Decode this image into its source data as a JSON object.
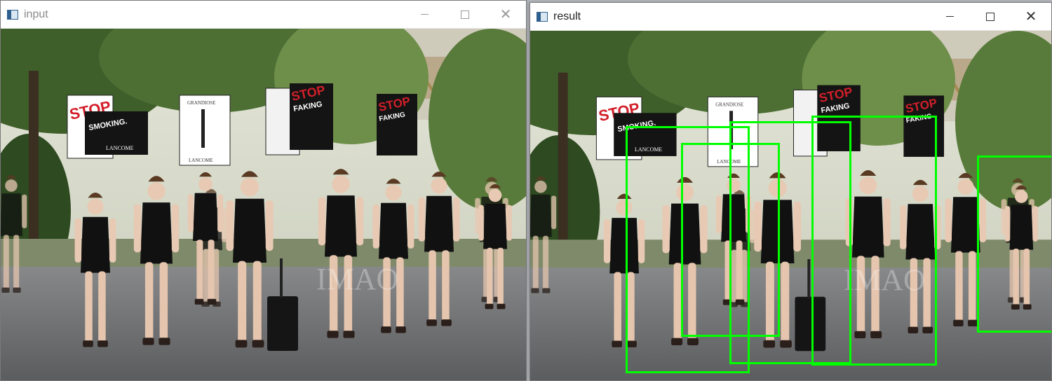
{
  "windows": {
    "input": {
      "title": "input",
      "controls": {
        "minimize": "minimize",
        "maximize": "maximize",
        "close": "close"
      }
    },
    "result": {
      "title": "result",
      "controls": {
        "minimize": "minimize",
        "maximize": "maximize",
        "close": "close"
      },
      "detection_color": "#00ff00"
    }
  },
  "photo": {
    "sign_texts": {
      "stop": "STOP",
      "smoking": "SMOKING.",
      "faking": "FAKING",
      "brand": "LANCOME",
      "grandiose": "GRANDIOSE"
    },
    "watermark": "IMAO"
  },
  "colors": {
    "detection_box": "#00ff00",
    "sky": "#d8dcc8",
    "foliage": "#4d6f34",
    "road": "#6f6f70"
  }
}
